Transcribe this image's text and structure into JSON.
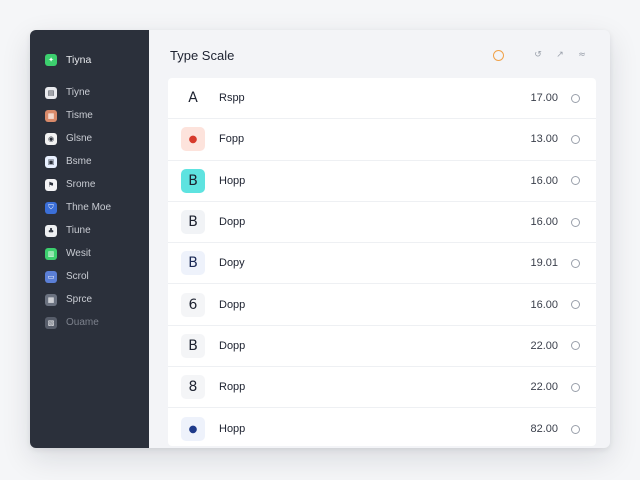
{
  "sidebar": {
    "brand": {
      "label": "Tiyna",
      "color": "#3ccf6e",
      "icon": "leaf-icon"
    },
    "items": [
      {
        "label": "Tiyne",
        "icon": "doc-icon",
        "color": "#e9eaee"
      },
      {
        "label": "Tisme",
        "icon": "box-icon",
        "color": "#d98a6a"
      },
      {
        "label": "Glsne",
        "icon": "circle-icon",
        "color": "#f2f2f2"
      },
      {
        "label": "Bsme",
        "icon": "app-icon",
        "color": "#e8f0ff"
      },
      {
        "label": "Srome",
        "icon": "flag-icon",
        "color": "#f4f4f6"
      },
      {
        "label": "Thne Moe",
        "icon": "shield-icon",
        "color": "#3b6fd8"
      },
      {
        "label": "Tiune",
        "icon": "tree-icon",
        "color": "#eef0f2"
      },
      {
        "label": "Wesit",
        "icon": "chart-icon",
        "color": "#3ccf6e"
      },
      {
        "label": "Scrol",
        "icon": "window-icon",
        "color": "#5b7fd6"
      },
      {
        "label": "Sprce",
        "icon": "grid-icon",
        "color": "#6b7280"
      },
      {
        "label": "Ouame",
        "icon": "image-icon",
        "color": "#575d6a"
      }
    ]
  },
  "header": {
    "title": "Type Scale",
    "accent": "#f0a24a"
  },
  "rows": [
    {
      "glyph": "A",
      "name": "Rspp",
      "value": "17.00",
      "bg": "#ffffff",
      "fg": "#1d2230"
    },
    {
      "glyph": "●",
      "name": "Fopp",
      "value": "13.00",
      "bg": "#fde3dc",
      "fg": "#d73a2b"
    },
    {
      "glyph": "B",
      "name": "Hopp",
      "value": "16.00",
      "bg": "#5ee3e0",
      "fg": "#1d2230"
    },
    {
      "glyph": "B",
      "name": "Dopp",
      "value": "16.00",
      "bg": "#f1f3f6",
      "fg": "#1d2230"
    },
    {
      "glyph": "B",
      "name": "Dopy",
      "value": "19.01",
      "bg": "#eef2fb",
      "fg": "#1b2a56"
    },
    {
      "glyph": "6",
      "name": "Dopp",
      "value": "16.00",
      "bg": "#f4f5f7",
      "fg": "#1d2230"
    },
    {
      "glyph": "B",
      "name": "Dopp",
      "value": "22.00",
      "bg": "#f4f5f7",
      "fg": "#1d2230"
    },
    {
      "glyph": "8",
      "name": "Ropp",
      "value": "22.00",
      "bg": "#f4f5f7",
      "fg": "#1d2230"
    },
    {
      "glyph": "●",
      "name": "Hopp",
      "value": "82.00",
      "bg": "#eef2fb",
      "fg": "#1e3a8a"
    }
  ]
}
